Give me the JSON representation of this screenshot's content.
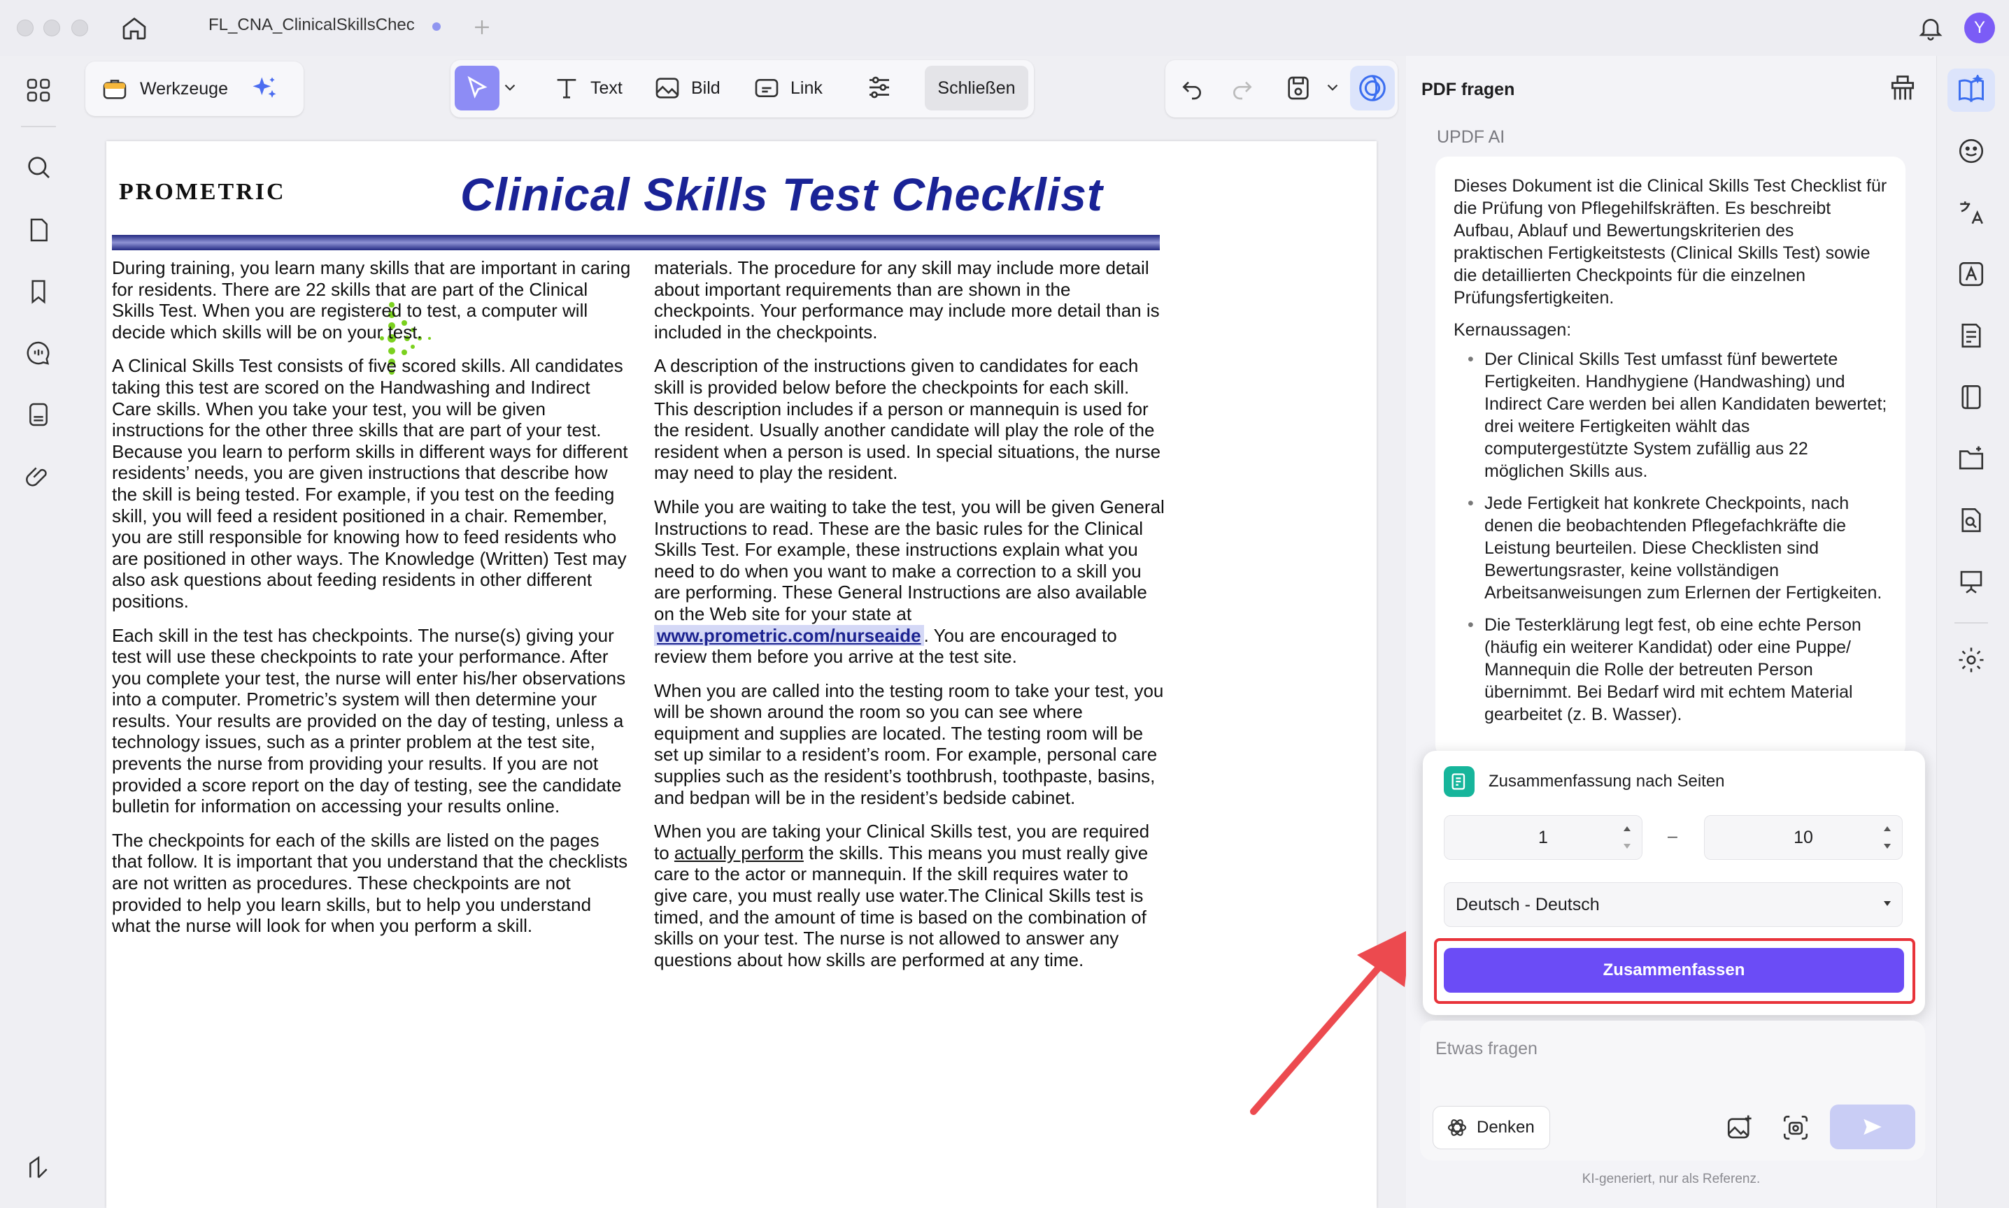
{
  "window": {
    "tab_title": "FL_CNA_ClinicalSkillsChec",
    "user_initial": "Y"
  },
  "toolbar": {
    "tools_label": "Werkzeuge",
    "text_label": "Text",
    "image_label": "Bild",
    "link_label": "Link",
    "close_label": "Schließen"
  },
  "document": {
    "logo_text": "PROMETRIC",
    "title": "Clinical Skills Test Checklist",
    "left_paragraphs": [
      "During training, you learn many skills that are important in caring for residents. There are 22 skills that are part of the Clinical Skills Test. When you are registered to test, a computer will decide which skills will be on your test.",
      "A Clinical Skills Test consists of five scored skills. All candidates taking this test are scored on the Handwashing and Indirect Care skills. When you take your test, you will be given instructions for the other three skills that are part of your test. Because you learn to perform skills in different ways for different residents’ needs, you are given instructions that describe how the skill is being tested. For example, if you test on the feeding skill, you will feed a resident positioned in a chair. Remember, you are still responsible for knowing how to feed residents who are positioned in other ways. The Knowledge (Written) Test may also ask questions about feeding residents in other different positions.",
      "Each skill in the test has checkpoints. The nurse(s) giving your test will use these checkpoints to rate your performance. After you complete your test, the nurse will enter his/her observations into a computer. Prometric’s system will then determine your results. Your results are provided on the day of testing, unless a technology issues, such as a printer problem at the test site, prevents the nurse from providing your results. If you are not provided a score report on the day of testing, see the candidate bulletin for information on accessing your results online.",
      "The checkpoints for each of the skills are listed on the pages that follow. It is important that you understand that the checklists are not written as procedures. These checkpoints are not provided to help you learn skills, but to help you understand what the nurse will look for when you perform a skill."
    ],
    "right_p1": "materials. The procedure for any skill may include more detail about important requirements than are shown in the checkpoints. Your performance may include more detail than is included in the checkpoints.",
    "right_p2": "A description of the instructions given to candidates for each skill is provided below before the checkpoints for each skill. This description includes if a person or mannequin is used for the resident. Usually another candidate will play the role of the resident when a person is used. In special situations, the nurse may need to play the resident.",
    "right_p3_before": "While you are waiting to take the test, you will be given General Instructions to read. These are the basic rules for the Clinical Skills Test. For example, these instructions explain what you need to do when you want to make a correction to a skill you are performing. These General Instructions are also available on the Web site for your state at ",
    "right_p3_link": "www.prometric.com/nurseaide",
    "right_p3_after": ". You are encouraged to review them before you arrive at the test site.",
    "right_p4": "When you are called into the testing room to take your test, you will be shown around the room so you can see where equipment and supplies are located. The testing room will be set up similar to a resident’s room. For example, personal care supplies such as the resident’s toothbrush, toothpaste, basins, and bedpan will be in the resident’s bedside cabinet.",
    "right_p5_before": "When you are taking your Clinical Skills test, you are required to ",
    "right_p5_underline": "actually perform",
    "right_p5_after": " the skills. This means you must really give care to the actor or mannequin. If the skill requires water to give care, you must really use water.The Clinical Skills test is timed, and the amount of time is based on the combination of skills on your test. The nurse is not allowed to answer any questions about how skills are performed at any time."
  },
  "panel": {
    "title": "PDF fragen",
    "ai_label": "UPDF AI",
    "summary_intro": "Dieses Dokument ist die Clinical Skills Test Checklist für die Prüfung von Pflegehilfskräften. Es beschreibt Aufbau, Ablauf und Bewertungskriterien des praktischen Fertigkeitstests (Clinical Skills Test) sowie die detaillierten Checkpoints für die einzelnen Prüfungsfertigkeiten.",
    "key_heading": "Kernaussagen:",
    "bullets": [
      "Der Clinical Skills Test umfasst fünf bewertete Fertigkeiten. Handhygiene (Handwashing) und Indirect Care werden bei allen Kandidaten bewertet; drei weitere Fertigkeiten wählt das computergestützte System zufällig aus 22 möglichen Skills aus.",
      "Jede Fertigkeit hat konkrete Checkpoints, nach denen die beobachtenden Pflegefachkräfte die Leistung beurteilen. Diese Checklisten sind Bewertungsraster, keine vollständigen Arbeitsanweisungen zum Erlernen der Fertigkeiten.",
      "Die Testerklärung legt fest, ob eine echte Person (häufig ein weiterer Kandidat) oder eine Puppe/ Mannequin die Rolle der betreuten Person übernimmt. Bei Bedarf wird mit echtem Material gearbeitet (z. B. Wasser)."
    ],
    "popup": {
      "title": "Zusammenfassung nach Seiten",
      "from_page": "1",
      "separator": "–",
      "to_page": "10",
      "language": "Deutsch - Deutsch",
      "submit_label": "Zusammenfassen"
    },
    "ask_placeholder": "Etwas fragen",
    "think_label": "Denken",
    "footer_note": "KI-generiert, nur als Referenz."
  },
  "colors": {
    "accent": "#6b4cf6",
    "highlight_red": "#e8333a",
    "doc_title_blue": "#1a2396"
  }
}
